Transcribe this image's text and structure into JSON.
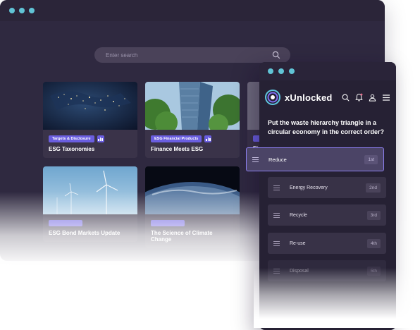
{
  "desktop": {
    "search": {
      "placeholder": "Enter search"
    },
    "cards": [
      {
        "tag": "Targets & Disclosure",
        "title": "ESG Taxonomies"
      },
      {
        "tag": "ESG Financial Products",
        "title": "Finance Meets ESG"
      },
      {
        "title": "Fi"
      },
      {
        "tag": "",
        "title": "ESG Bond Markets Update"
      },
      {
        "tag": "",
        "title": "The Science of Climate Change"
      }
    ]
  },
  "mobile": {
    "brand": "xUnlocked",
    "question": "Put the waste hierarchy triangle in a circular economy in the correct order?",
    "options": [
      {
        "label": "Reduce",
        "rank": "1st"
      },
      {
        "label": "Energy Recovery",
        "rank": "2nd"
      },
      {
        "label": "Recycle",
        "rank": "3rd"
      },
      {
        "label": "Re-use",
        "rank": "4th"
      },
      {
        "label": "Disposal",
        "rank": "5th"
      }
    ]
  },
  "colors": {
    "accent": "#6a5ee0",
    "window_bg": "#2f2940",
    "traffic_dot": "#61c4d6"
  }
}
